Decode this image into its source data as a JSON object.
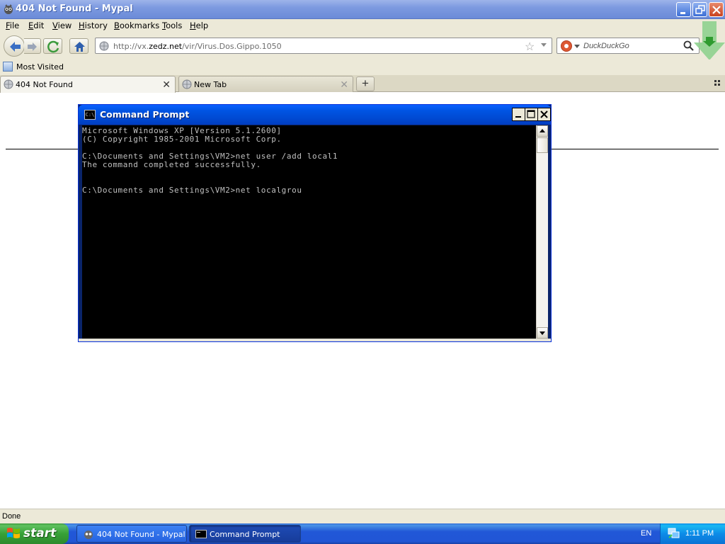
{
  "window": {
    "title": "404 Not Found - Mypal"
  },
  "menu": {
    "items": [
      {
        "label": "File",
        "key": "F",
        "rest": "ile"
      },
      {
        "label": "Edit",
        "key": "E",
        "rest": "dit"
      },
      {
        "label": "View",
        "key": "V",
        "rest": "iew"
      },
      {
        "label": "History",
        "key": "H",
        "rest": "istory"
      },
      {
        "label": "Bookmarks",
        "key": "B",
        "rest": "ookmarks"
      },
      {
        "label": "Tools",
        "key": "T",
        "rest": "ools"
      },
      {
        "label": "Help",
        "key": "H",
        "rest": "elp"
      }
    ]
  },
  "navigation": {
    "url_prefix": "http://vx.",
    "url_host": "zedz.net",
    "url_path": "/vir/Virus.Dos.Gippo.1050",
    "search_placeholder": "DuckDuckGo"
  },
  "bookmarks": {
    "items": [
      {
        "label": "Most Visited"
      }
    ]
  },
  "tabs": [
    {
      "label": "404 Not Found",
      "active": true
    },
    {
      "label": "New Tab",
      "active": false
    }
  ],
  "status": {
    "text": "Done"
  },
  "cmd": {
    "title": "Command Prompt",
    "icon_text": "C:\\",
    "lines": [
      "Microsoft Windows XP [Version 5.1.2600]",
      "(C) Copyright 1985-2001 Microsoft Corp.",
      "",
      "C:\\Documents and Settings\\VM2>net user /add local1",
      "The command completed successfully.",
      "",
      "",
      "C:\\Documents and Settings\\VM2>net localgrou"
    ]
  },
  "taskbar": {
    "start_label": "start",
    "items": [
      {
        "label": "404 Not Found - Mypal"
      },
      {
        "label": "Command Prompt"
      }
    ],
    "language": "EN",
    "clock": "1:11 PM"
  },
  "colors": {
    "accent": "#0054e3",
    "download_arrow": "#37b24d"
  }
}
